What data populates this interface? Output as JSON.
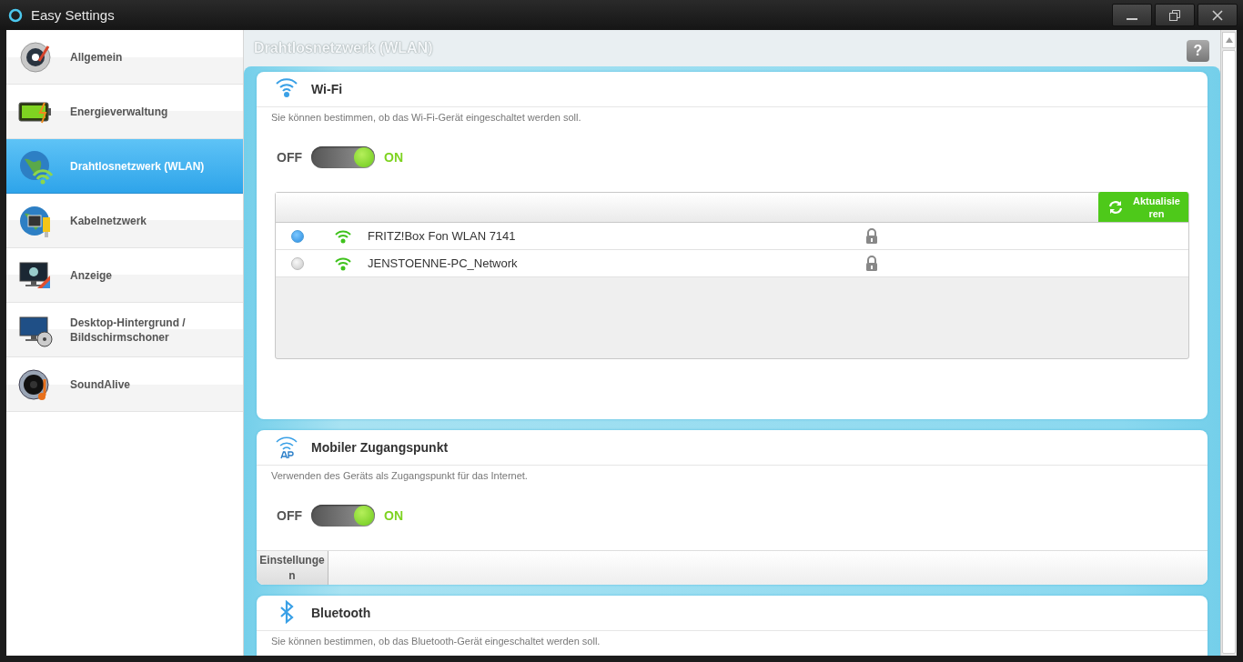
{
  "window": {
    "title": "Easy Settings"
  },
  "sidebar": {
    "items": [
      {
        "label": "Allgemein",
        "selected": false
      },
      {
        "label": "Energieverwaltung",
        "selected": false
      },
      {
        "label": "Drahtlosnetzwerk (WLAN)",
        "selected": true
      },
      {
        "label": "Kabelnetzwerk",
        "selected": false
      },
      {
        "label": "Anzeige",
        "selected": false
      },
      {
        "label": "Desktop-Hintergrund / Bildschirmschoner",
        "selected": false
      },
      {
        "label": "SoundAlive",
        "selected": false
      }
    ]
  },
  "page": {
    "heading": "Drahtlosnetzwerk (WLAN)",
    "help": "?"
  },
  "sections": [
    {
      "kind": "wifi",
      "title": "Wi-Fi",
      "description": "Sie können bestimmen, ob das Wi-Fi-Gerät eingeschaltet werden soll.",
      "toggle": {
        "off_label": "OFF",
        "on_label": "ON",
        "on": true
      },
      "networks": {
        "refresh": "Aktualisieren",
        "rows": [
          {
            "name": "FRITZ!Box Fon WLAN 7141",
            "selected": true,
            "secured": true
          },
          {
            "name": "JENSTOENNE-PC_Network",
            "selected": false,
            "secured": true
          }
        ]
      }
    },
    {
      "kind": "hotspot",
      "title": "Mobiler Zugangspunkt",
      "description": "Verwenden des Geräts als Zugangspunkt für das Internet.",
      "toggle": {
        "off_label": "OFF",
        "on_label": "ON",
        "on": true
      },
      "settings": "Einstellungen"
    },
    {
      "kind": "bluetooth",
      "title": "Bluetooth",
      "description": "Sie können bestimmen, ob das Bluetooth-Gerät eingeschaltet werden soll."
    }
  ]
}
